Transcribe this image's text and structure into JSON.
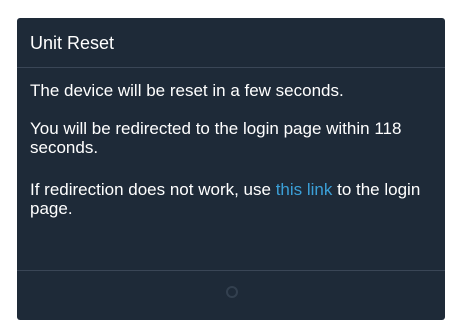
{
  "dialog": {
    "title": "Unit Reset",
    "message_reset": "The device will be reset in a few seconds.",
    "message_redirect": "You will be redirected to the login page within 118 seconds.",
    "message_fallback_before": "If redirection does not work, use ",
    "message_fallback_link": "this link",
    "message_fallback_after": " to the login page.",
    "countdown_seconds": 118
  },
  "colors": {
    "dialog_background": "#1e2a38",
    "divider": "#3a4656",
    "text": "#ffffff",
    "link": "#3ba0d8",
    "spinner": "#33404f"
  },
  "icons": {
    "footer_spinner": "loading-spinner-icon"
  }
}
